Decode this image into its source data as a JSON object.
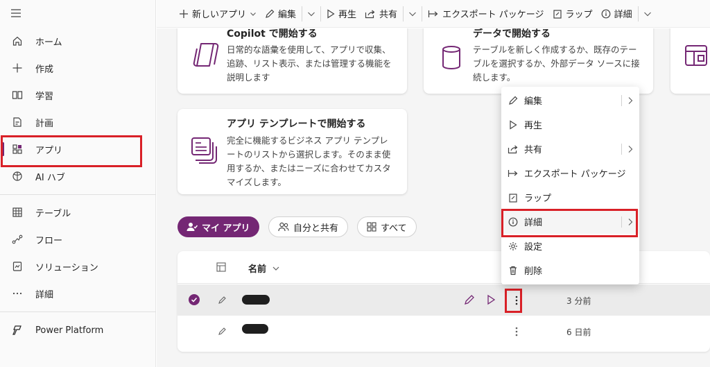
{
  "toolbar": {
    "new_app": "新しいアプリ",
    "edit": "編集",
    "play": "再生",
    "share": "共有",
    "export_package": "エクスポート パッケージ",
    "wrap": "ラップ",
    "details": "詳細"
  },
  "sidebar": {
    "items": [
      {
        "label": "ホーム",
        "icon": "home-icon"
      },
      {
        "label": "作成",
        "icon": "plus-icon"
      },
      {
        "label": "学習",
        "icon": "book-icon"
      },
      {
        "label": "計画",
        "icon": "plan-icon"
      },
      {
        "label": "アプリ",
        "icon": "apps-icon",
        "active": true
      },
      {
        "label": "AI ハブ",
        "icon": "ai-hub-icon"
      },
      {
        "label": "テーブル",
        "icon": "table-icon"
      },
      {
        "label": "フロー",
        "icon": "flow-icon"
      },
      {
        "label": "ソリューション",
        "icon": "solution-icon"
      },
      {
        "label": "詳細",
        "icon": "more-icon"
      },
      {
        "label": "Power Platform",
        "icon": "power-platform-icon"
      }
    ]
  },
  "cards": {
    "copilot": {
      "title": "Copilot で開始する",
      "desc": "日常的な語彙を使用して、アプリで収集、追跡、リスト表示、または管理する機能を説明します"
    },
    "data": {
      "title": "データで開始する",
      "desc": "テーブルを新しく作成するか、既存のテーブルを選択するか、外部データ ソースに接続します。"
    },
    "template": {
      "title": "アプリ テンプレートで開始する",
      "desc": "完全に機能するビジネス アプリ テンプレートのリストから選択します。そのまま使用するか、またはニーズに合わせてカスタマイズします。"
    }
  },
  "filters": {
    "my_apps": "マイ アプリ",
    "shared_with_me": "自分と共有",
    "all": "すべて"
  },
  "table": {
    "col_name": "名前",
    "rows": [
      {
        "modified": "3 分前",
        "selected": true
      },
      {
        "modified": "6 日前",
        "selected": false
      }
    ]
  },
  "context_menu": {
    "items": [
      {
        "label": "編集",
        "icon": "pencil-icon",
        "submenu": true
      },
      {
        "label": "再生",
        "icon": "play-icon",
        "submenu": false
      },
      {
        "label": "共有",
        "icon": "share-icon",
        "submenu": true
      },
      {
        "label": "エクスポート パッケージ",
        "icon": "export-icon",
        "submenu": false
      },
      {
        "label": "ラップ",
        "icon": "wrap-icon",
        "submenu": false
      },
      {
        "label": "詳細",
        "icon": "info-icon",
        "submenu": true,
        "highlighted": true
      },
      {
        "label": "設定",
        "icon": "settings-icon",
        "submenu": false
      },
      {
        "label": "削除",
        "icon": "delete-icon",
        "submenu": false
      }
    ]
  },
  "colors": {
    "accent": "#742774",
    "highlight_box": "#d92027"
  }
}
